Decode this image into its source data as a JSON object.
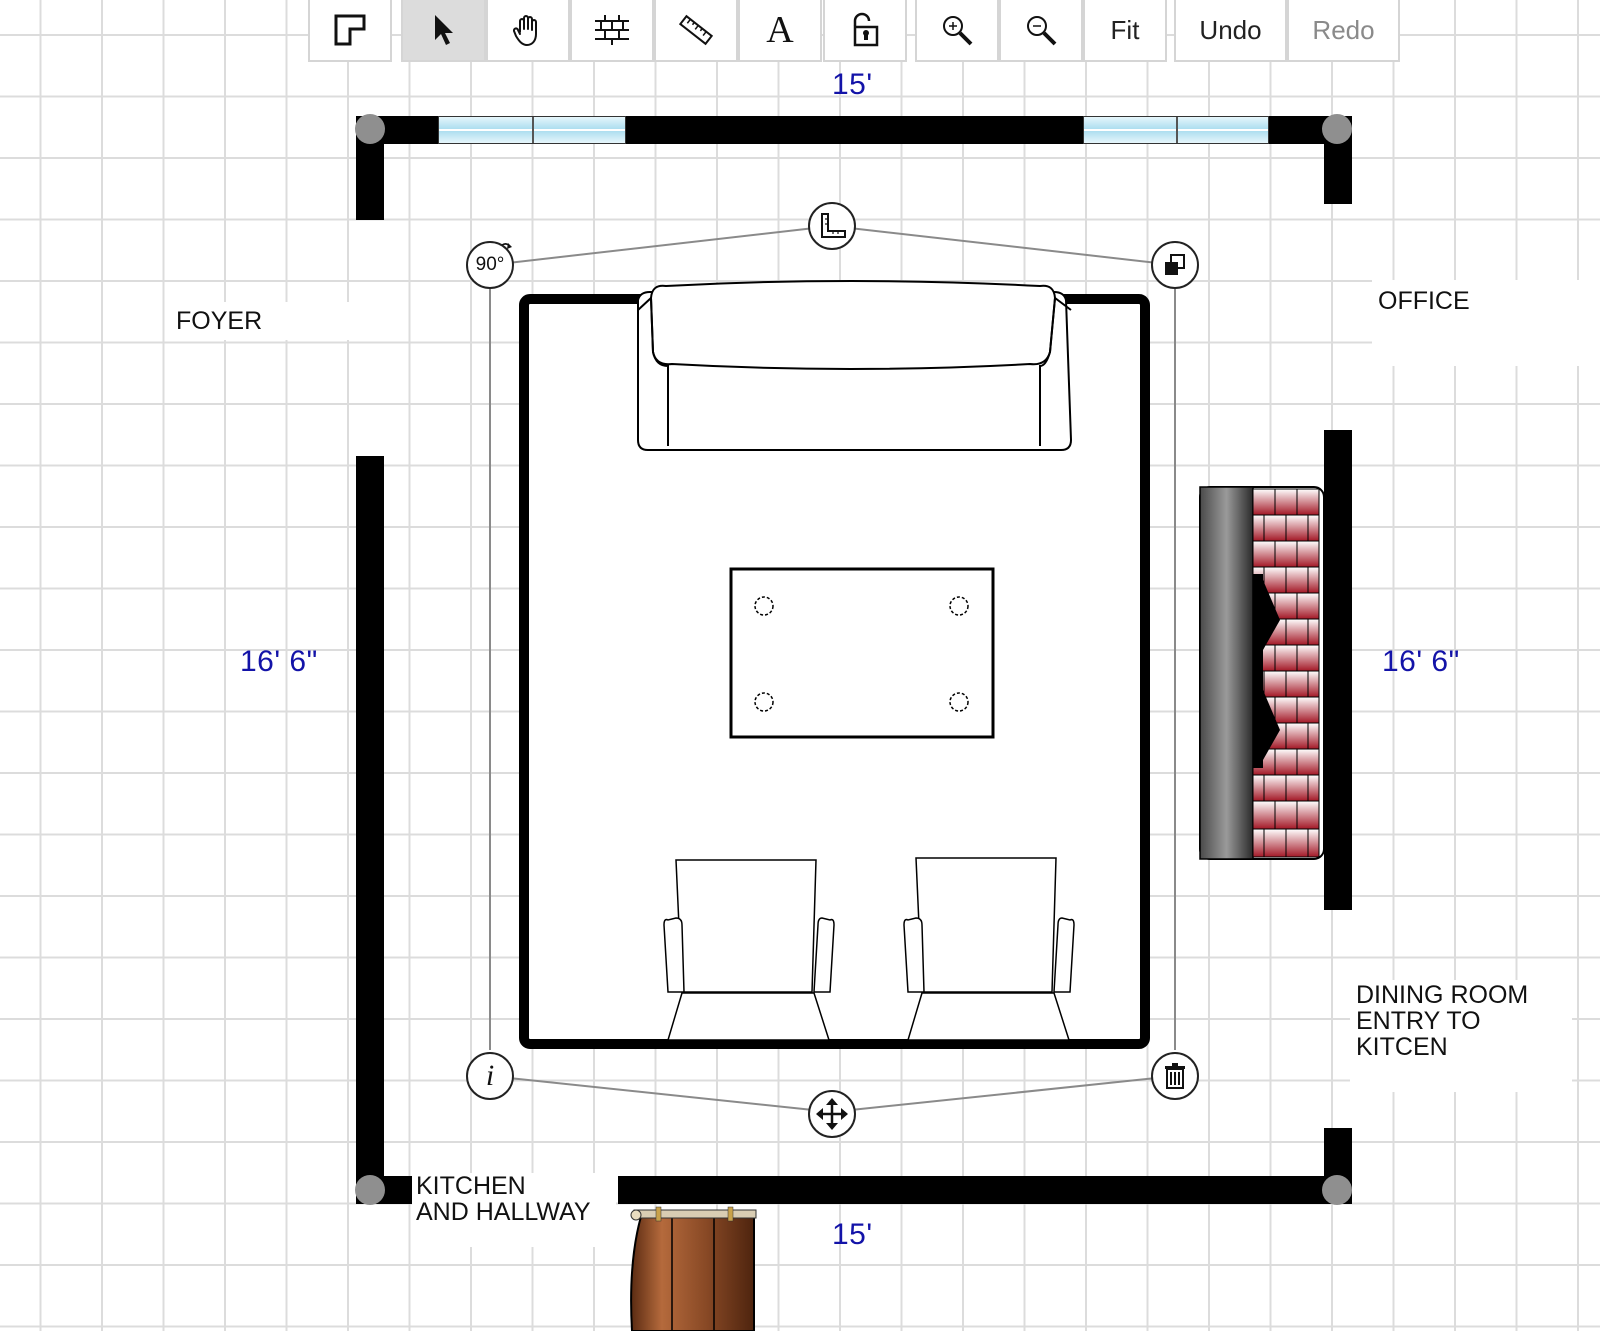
{
  "toolbar": {
    "buttons": [
      {
        "name": "draw-wall-tool",
        "icon": "wall-corner-icon"
      },
      {
        "name": "select-tool",
        "icon": "arrow-pointer-icon",
        "active": true
      },
      {
        "name": "pan-tool",
        "icon": "hand-icon"
      },
      {
        "name": "grid-tool",
        "icon": "brick-grid-icon"
      },
      {
        "name": "measure-tool",
        "icon": "ruler-icon"
      },
      {
        "name": "text-tool",
        "icon": "text-a-icon",
        "label": "A"
      },
      {
        "name": "lock-tool",
        "icon": "unlock-icon"
      },
      {
        "name": "zoom-in-tool",
        "icon": "zoom-in-icon"
      },
      {
        "name": "zoom-out-tool",
        "icon": "zoom-out-icon"
      }
    ],
    "fit_label": "Fit",
    "undo_label": "Undo",
    "redo_label": "Redo"
  },
  "dimensions": {
    "top": "15'",
    "bottom": "15'",
    "left": "16' 6\"",
    "right": "16' 6\""
  },
  "rooms": {
    "foyer": "FOYER",
    "office": "OFFICE",
    "dining": [
      "DINING ROOM",
      "ENTRY TO",
      "KITCEN"
    ],
    "kitchen": [
      "KITCHEN",
      "AND HALLWAY"
    ]
  },
  "handles": {
    "rotate_label": "90°",
    "info_label": "i"
  },
  "colors": {
    "dimension_text": "#1313a8",
    "wall": "#000000",
    "grid": "#dcdcdc",
    "brick": "#b01f2a",
    "door_wood": "#8a4a26"
  }
}
